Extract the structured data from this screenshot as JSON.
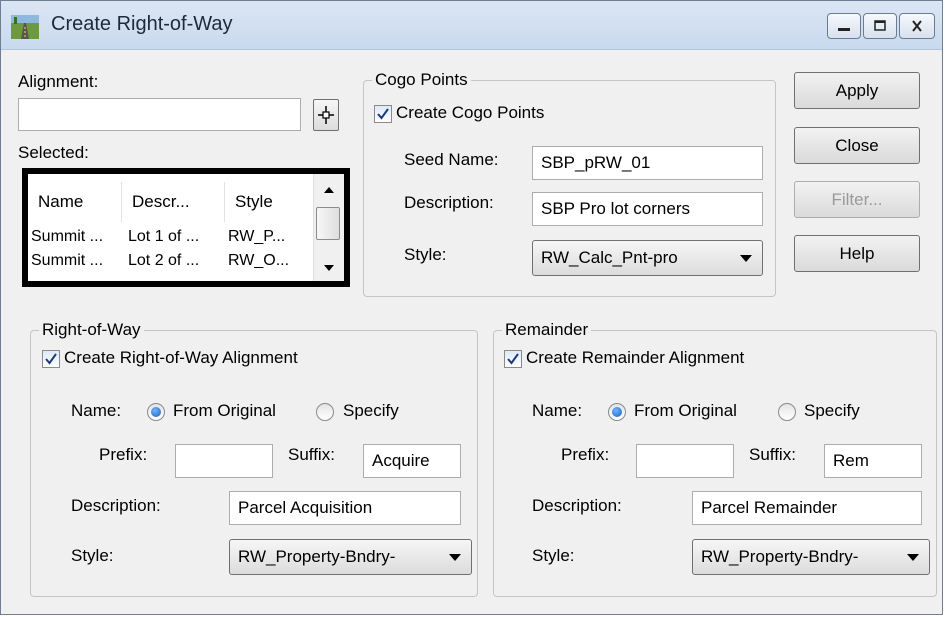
{
  "window": {
    "title": "Create Right-of-Way"
  },
  "alignment": {
    "label": "Alignment:",
    "value": ""
  },
  "selected": {
    "label": "Selected:",
    "columns": [
      "Name",
      "Descr...",
      "Style"
    ],
    "rows": [
      [
        "Summit ...",
        "Lot 1 of ...",
        "RW_P..."
      ],
      [
        "Summit ...",
        "Lot 2 of ...",
        "RW_O..."
      ]
    ]
  },
  "cogo": {
    "group_label": "Cogo Points",
    "create_label": "Create Cogo Points",
    "create_checked": true,
    "seed_name_label": "Seed Name:",
    "seed_name_value": "SBP_pRW_01",
    "description_label": "Description:",
    "description_value": "SBP Pro lot corners",
    "style_label": "Style:",
    "style_value": "RW_Calc_Pnt-pro"
  },
  "buttons": {
    "apply": "Apply",
    "close": "Close",
    "filter": "Filter...",
    "help": "Help"
  },
  "row": {
    "group_label": "Right-of-Way",
    "create_label": "Create Right-of-Way Alignment",
    "create_checked": true,
    "name_label": "Name:",
    "from_original": "From Original",
    "specify": "Specify",
    "name_mode": "From Original",
    "prefix_label": "Prefix:",
    "prefix_value": "",
    "suffix_label": "Suffix:",
    "suffix_value": "Acquire",
    "description_label": "Description:",
    "description_value": "Parcel Acquisition",
    "style_label": "Style:",
    "style_value": "RW_Property-Bndry-"
  },
  "remainder": {
    "group_label": "Remainder",
    "create_label": "Create Remainder Alignment",
    "create_checked": true,
    "name_label": "Name:",
    "from_original": "From Original",
    "specify": "Specify",
    "name_mode": "From Original",
    "prefix_label": "Prefix:",
    "prefix_value": "",
    "suffix_label": "Suffix:",
    "suffix_value": "Rem",
    "description_label": "Description:",
    "description_value": "Parcel Remainder",
    "style_label": "Style:",
    "style_value": "RW_Property-Bndry-"
  },
  "icons": {
    "app": "road-icon",
    "minimize": "minimize-icon",
    "maximize": "maximize-icon",
    "close": "close-icon",
    "pick": "crosshair-pick-icon",
    "checkmark": "checkmark-icon"
  }
}
